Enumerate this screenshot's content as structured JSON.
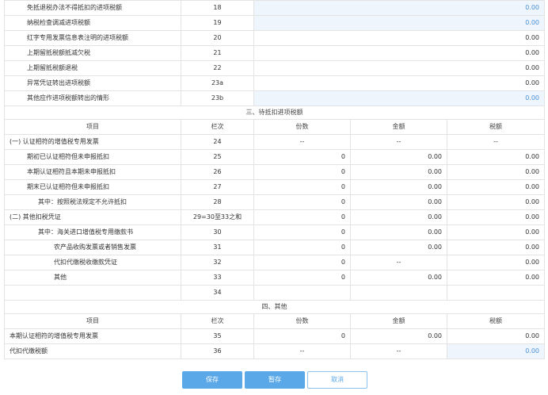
{
  "top_rows": [
    {
      "label": "免抵退税办法不得抵扣的进项税额",
      "no": "18",
      "val": "0.00",
      "blue": true
    },
    {
      "label": "纳税检查调减进项税额",
      "no": "19",
      "val": "0.00",
      "blue": true
    },
    {
      "label": "红字专用发票信息表注明的进项税额",
      "no": "20",
      "val": "0.00",
      "blue": false
    },
    {
      "label": "上期留抵税额抵减欠税",
      "no": "21",
      "val": "0.00",
      "blue": false
    },
    {
      "label": "上期留抵税额退税",
      "no": "22",
      "val": "0.00",
      "blue": false
    },
    {
      "label": "异常凭证转出进项税额",
      "no": "23a",
      "val": "0.00",
      "blue": false
    },
    {
      "label": "其他应作进项税额转出的情形",
      "no": "23b",
      "val": "0.00",
      "blue": true
    }
  ],
  "section3": {
    "title": "三、待抵扣进项税额",
    "headers": {
      "item": "项目",
      "col": "栏次",
      "count": "份数",
      "amount": "金额",
      "tax": "税额"
    },
    "rows": [
      {
        "label": "(一) 认证相符的增值税专用发票",
        "no": "24",
        "count": "--",
        "amount": "--",
        "tax": "--",
        "indent": 0,
        "dash": true
      },
      {
        "label": "期初已认证相符但未申报抵扣",
        "no": "25",
        "count": "0",
        "amount": "0.00",
        "tax": "0.00",
        "indent": 1
      },
      {
        "label": "本期认证相符且本期未申报抵扣",
        "no": "26",
        "count": "0",
        "amount": "0.00",
        "tax": "0.00",
        "indent": 1
      },
      {
        "label": "期末已认证相符但未申报抵扣",
        "no": "27",
        "count": "0",
        "amount": "0.00",
        "tax": "0.00",
        "indent": 1
      },
      {
        "label": "其中：按照税法规定不允许抵扣",
        "no": "28",
        "count": "0",
        "amount": "0.00",
        "tax": "0.00",
        "indent": 2
      },
      {
        "label": "(二) 其他扣税凭证",
        "no": "29=30至33之和",
        "count": "0",
        "amount": "0.00",
        "tax": "0.00",
        "indent": 0
      },
      {
        "label": "其中：海关进口增值税专用缴款书",
        "no": "30",
        "count": "0",
        "amount": "0.00",
        "tax": "0.00",
        "indent": 2
      },
      {
        "label": "农产品收购发票或者销售发票",
        "no": "31",
        "count": "0",
        "amount": "0.00",
        "tax": "0.00",
        "indent": 3
      },
      {
        "label": "代扣代缴税收缴款凭证",
        "no": "32",
        "count": "0",
        "amount": "--",
        "tax": "0.00",
        "indent": 3,
        "amount_dash": true
      },
      {
        "label": "其他",
        "no": "33",
        "count": "0",
        "amount": "0.00",
        "tax": "0.00",
        "indent": 3
      },
      {
        "label": "",
        "no": "34",
        "count": "",
        "amount": "",
        "tax": "",
        "indent": 0
      }
    ]
  },
  "section4": {
    "title": "四、其他",
    "headers": {
      "item": "项目",
      "col": "栏次",
      "count": "份数",
      "amount": "金额",
      "tax": "税额"
    },
    "rows": [
      {
        "label": "本期认证相符的增值税专用发票",
        "no": "35",
        "count": "0",
        "amount": "0.00",
        "tax": "0.00"
      },
      {
        "label": "代扣代缴税额",
        "no": "36",
        "count": "--",
        "amount": "--",
        "tax": "0.00",
        "dash": true,
        "blue": true
      }
    ]
  },
  "buttons": {
    "save": "保存",
    "draft": "暂存",
    "cancel": "取消"
  }
}
